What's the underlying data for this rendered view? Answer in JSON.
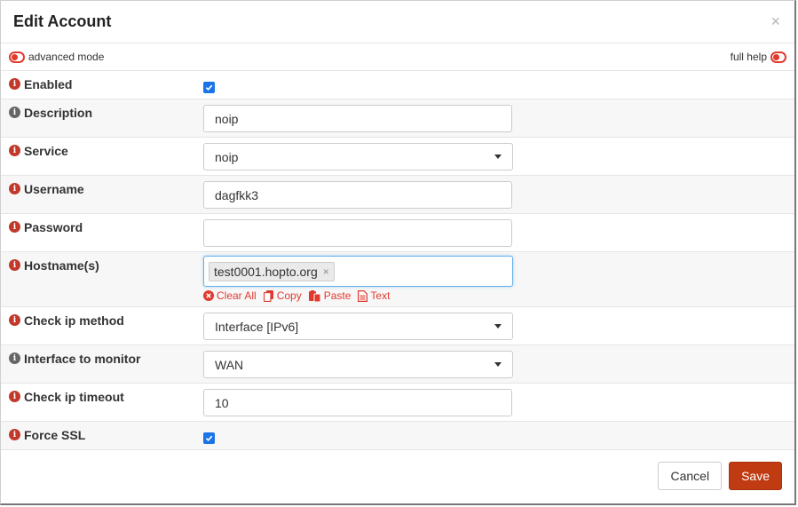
{
  "dialog": {
    "title": "Edit Account",
    "close": "×"
  },
  "mode": {
    "advanced_label": "advanced mode",
    "help_label": "full help"
  },
  "fields": {
    "enabled": {
      "label": "Enabled",
      "checked": true
    },
    "description": {
      "label": "Description",
      "value": "noip"
    },
    "service": {
      "label": "Service",
      "value": "noip"
    },
    "username": {
      "label": "Username",
      "value": "dagfkk3"
    },
    "password": {
      "label": "Password",
      "value": ""
    },
    "hostnames": {
      "label": "Hostname(s)",
      "tags": [
        "test0001.hopto.org"
      ],
      "actions": {
        "clear": "Clear All",
        "copy": "Copy",
        "paste": "Paste",
        "text": "Text"
      }
    },
    "checkip_method": {
      "label": "Check ip method",
      "value": "Interface [IPv6]"
    },
    "interface": {
      "label": "Interface to monitor",
      "value": "WAN"
    },
    "checkip_timeout": {
      "label": "Check ip timeout",
      "value": "10"
    },
    "force_ssl": {
      "label": "Force SSL",
      "checked": true
    }
  },
  "footer": {
    "cancel": "Cancel",
    "save": "Save"
  },
  "colors": {
    "accent": "#c03a12",
    "link": "#e03a2e",
    "checkbox": "#1a73e8"
  }
}
